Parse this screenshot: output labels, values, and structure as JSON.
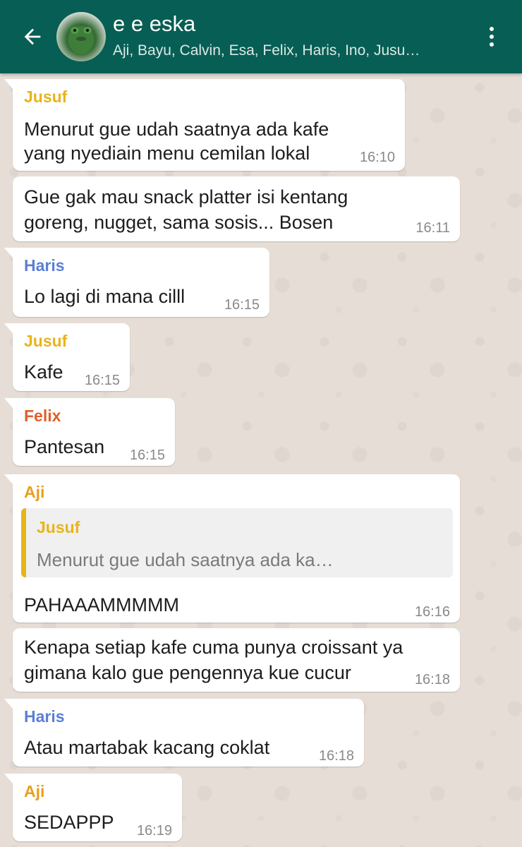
{
  "header": {
    "title": "e e eska",
    "subtitle": "Aji, Bayu, Calvin, Esa, Felix, Haris, Ino, Jusu…",
    "back_icon": "arrow-left-icon",
    "menu_icon": "more-vert-icon",
    "color": "#075e54"
  },
  "colors": {
    "Jusuf": "#e8b41c",
    "Haris": "#5b7fd6",
    "Felix": "#e05f2c",
    "Aji": "#e8a01c"
  },
  "messages": [
    {
      "sender": "Jusuf",
      "lines": [
        "Menurut gue udah saatnya ada kafe",
        "yang nyediain menu cemilan lokal"
      ],
      "time": "16:10"
    },
    {
      "sender": "",
      "lines": [
        "Gue gak mau snack platter isi kentang",
        "goreng, nugget, sama sosis... Bosen"
      ],
      "time": "16:11"
    },
    {
      "sender": "Haris",
      "lines": [
        "Lo lagi di mana cilll"
      ],
      "time": "16:15"
    },
    {
      "sender": "Jusuf",
      "lines": [
        "Kafe"
      ],
      "time": "16:15"
    },
    {
      "sender": "Felix",
      "lines": [
        "Pantesan"
      ],
      "time": "16:15"
    },
    {
      "sender": "Aji",
      "quote": {
        "sender": "Jusuf",
        "text": "Menurut gue udah saatnya ada ka…"
      },
      "lines": [
        "PAHAAAMMMMM"
      ],
      "time": "16:16"
    },
    {
      "sender": "",
      "lines": [
        "Kenapa setiap kafe cuma punya croissant ya",
        "gimana kalo gue pengennya kue cucur"
      ],
      "time": "16:18"
    },
    {
      "sender": "Haris",
      "lines": [
        "Atau martabak kacang coklat"
      ],
      "time": "16:18"
    },
    {
      "sender": "Aji",
      "lines": [
        "SEDAPPP"
      ],
      "time": "16:19"
    }
  ]
}
